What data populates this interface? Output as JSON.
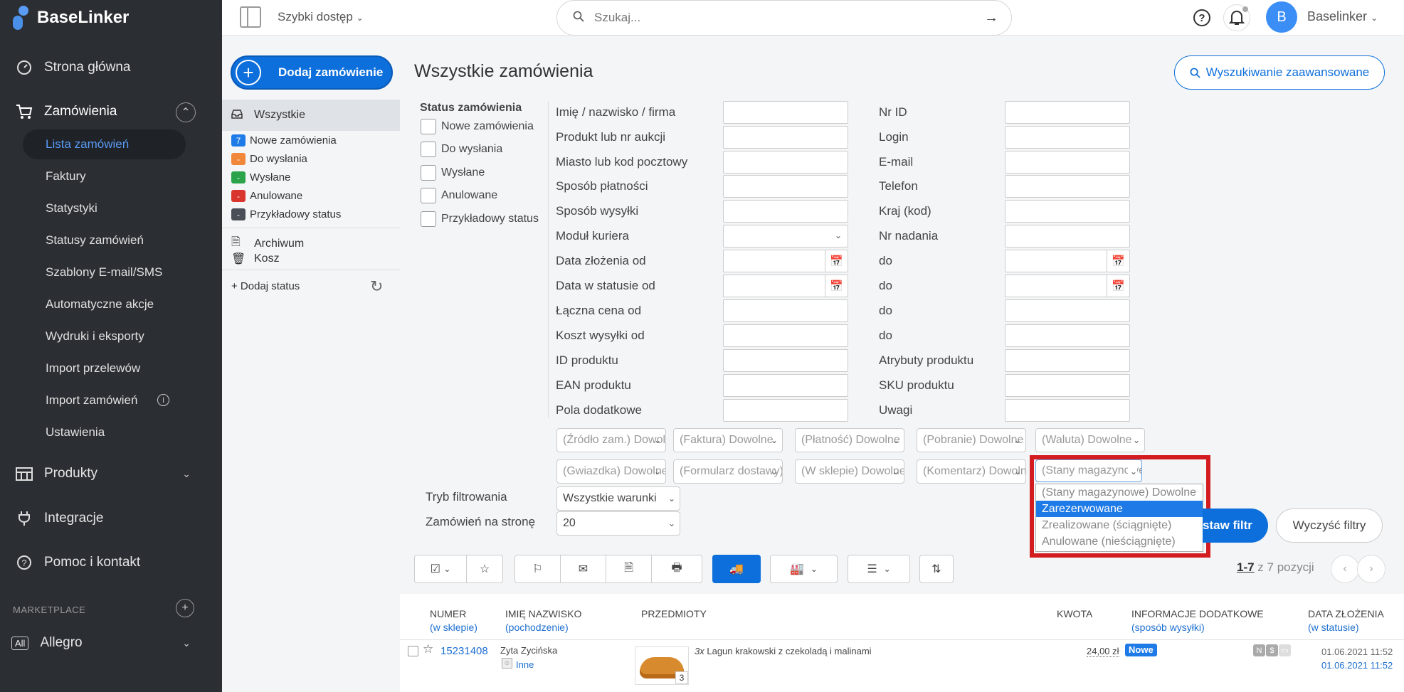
{
  "sidebar": {
    "logo": "BaseLinker",
    "items": [
      {
        "label": "Strona główna",
        "icon": "speedometer-icon"
      },
      {
        "label": "Zamówienia",
        "icon": "cart-icon"
      },
      {
        "label": "Produkty",
        "icon": "warehouse-icon"
      },
      {
        "label": "Integracje",
        "icon": "plug-icon"
      },
      {
        "label": "Pomoc i kontakt",
        "icon": "help-icon"
      }
    ],
    "sub_items": [
      "Lista zamówień",
      "Faktury",
      "Statystyki",
      "Statusy zamówień",
      "Szablony E-mail/SMS",
      "Automatyczne akcje",
      "Wydruki i eksporty",
      "Import przelewów",
      "Import zamówień",
      "Ustawienia"
    ],
    "marketplace_label": "MARKETPLACE",
    "allegro_tag": "All",
    "allegro_label": "Allegro"
  },
  "topbar": {
    "quick_access": "Szybki dostęp",
    "search_placeholder": "Szukaj...",
    "avatar_letter": "B",
    "user_name": "Baselinker"
  },
  "main": {
    "add_order": "Dodaj zamówienie",
    "title": "Wszystkie zamówienia",
    "advanced_search": "Wyszukiwanie zaawansowane"
  },
  "statuses": {
    "all": "Wszystkie",
    "list": [
      {
        "badge": "7",
        "label": "Nowe zamówienia",
        "color": "#1e7ae6"
      },
      {
        "badge": "-",
        "label": "Do wysłania",
        "color": "#f0873a"
      },
      {
        "badge": "-",
        "label": "Wysłane",
        "color": "#2aa34a"
      },
      {
        "badge": "-",
        "label": "Anulowane",
        "color": "#d9352e"
      },
      {
        "badge": "-",
        "label": "Przykładowy status",
        "color": "#4a4f57"
      }
    ],
    "archive": "Archiwum",
    "trash": "Kosz",
    "add_status": "+ Dodaj status"
  },
  "filters": {
    "status_heading": "Status zamówienia",
    "status_checkboxes": [
      "Nowe zamówienia",
      "Do wysłania",
      "Wysłane",
      "Anulowane",
      "Przykładowy status"
    ],
    "left_labels": [
      "Imię / nazwisko / firma",
      "Produkt lub nr aukcji",
      "Miasto lub kod pocztowy",
      "Sposób płatności",
      "Sposób wysyłki",
      "Moduł kuriera",
      "Data złożenia od",
      "Data w statusie od",
      "Łączna cena od",
      "Koszt wysyłki od",
      "ID produktu",
      "EAN produktu",
      "Pola dodatkowe"
    ],
    "right_labels": [
      "Nr ID",
      "Login",
      "E-mail",
      "Telefon",
      "Kraj (kod)",
      "Nr nadania",
      "do",
      "do",
      "do",
      "do",
      "Atrybuty produktu",
      "SKU produktu",
      "Uwagi"
    ],
    "dropdowns_row1": [
      "(Źródło zam.) Dowolne",
      "(Faktura) Dowolne",
      "(Płatność) Dowolne",
      "(Pobranie) Dowolne",
      "(Waluta) Dowolne"
    ],
    "dropdowns_row2": [
      "(Gwiazdka) Dowolne",
      "(Formularz dostawy) Dowolne",
      "(W sklepie) Dowolne",
      "(Komentarz) Dowolne",
      "(Stany magazynowe) Dowolne"
    ],
    "stock_options": [
      "(Stany magazynowe) Dowolne",
      "Zarezerwowane",
      "Zrealizowane (ściągnięte)",
      "Anulowane (nieściągnięte)"
    ],
    "mode_label": "Tryb filtrowania",
    "mode_value": "Wszystkie warunki",
    "per_page_label": "Zamówień na stronę",
    "per_page_value": "20",
    "apply": "staw filtr",
    "clear": "Wyczyść filtry"
  },
  "pagination": {
    "range": "1-7",
    "suffix": " z 7 pozycji"
  },
  "table": {
    "headers": [
      {
        "top": "NUMER",
        "sub": "(w sklepie)"
      },
      {
        "top": "IMIĘ NAZWISKO",
        "sub": "(pochodzenie)"
      },
      {
        "top": "PRZEDMIOTY",
        "sub": ""
      },
      {
        "top": "KWOTA",
        "sub": ""
      },
      {
        "top": "INFORMACJE DODATKOWE",
        "sub": "(sposób wysyłki)"
      },
      {
        "top": "DATA ZŁOŻENIA",
        "sub": "(w statusie)"
      }
    ],
    "row": {
      "number": "15231408",
      "name": "Zyta Zycińska",
      "origin": "Inne",
      "qty_prefix": "3x",
      "item": "Lagun krakowski z czekoladą i malinami",
      "thumb_qty": "3",
      "amount": "24,00 zł",
      "status_badge": "Nowe",
      "date1": "01.06.2021 11:52",
      "date2": "01.06.2021 11:52"
    }
  }
}
